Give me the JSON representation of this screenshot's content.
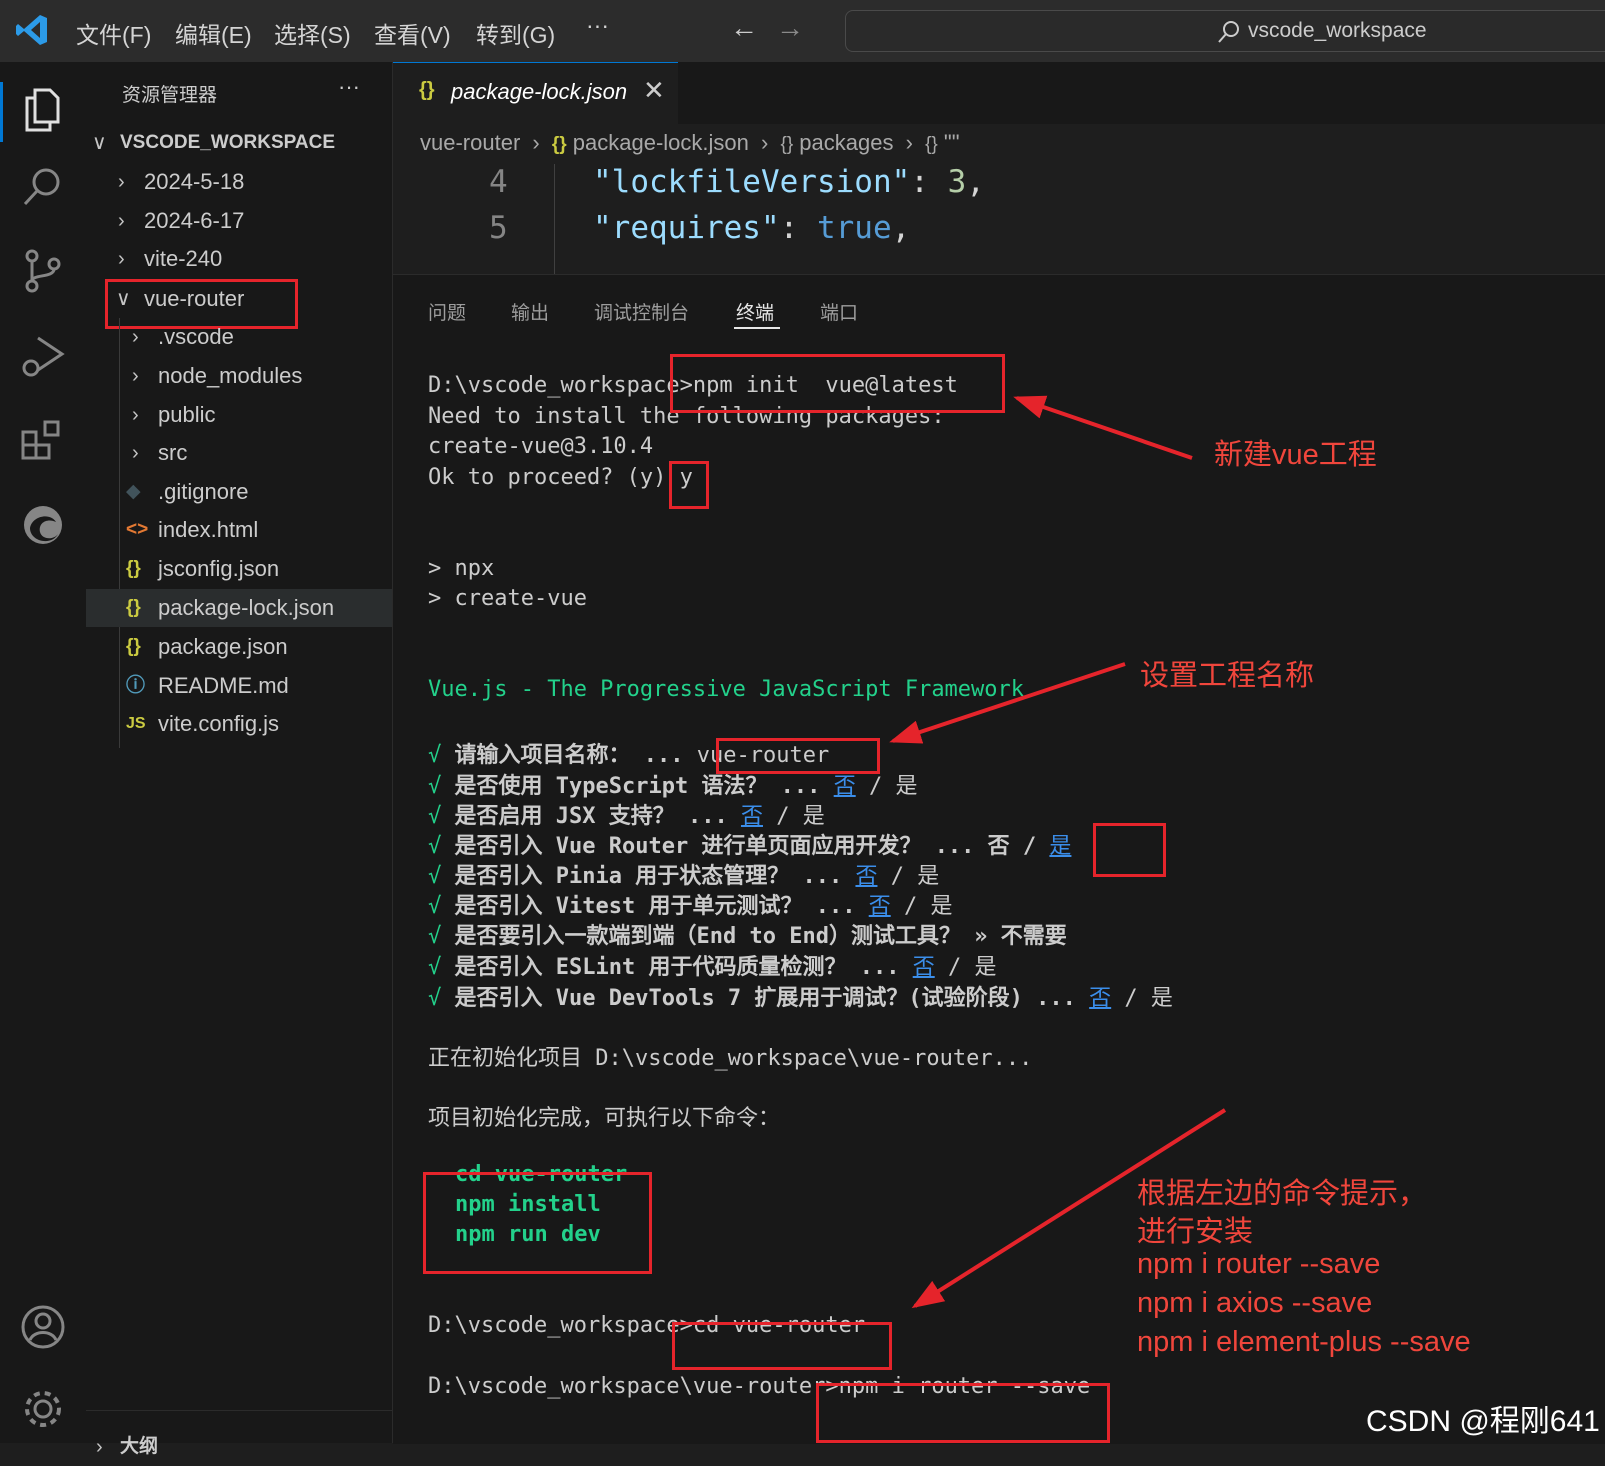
{
  "titlebar": {
    "menus": [
      "文件(F)",
      "编辑(E)",
      "选择(S)",
      "查看(V)",
      "转到(G)",
      "···"
    ],
    "search_text": "vscode_workspace"
  },
  "sidebar": {
    "title": "资源管理器",
    "more": "···",
    "workspace": "VSCODE_WORKSPACE",
    "items": [
      {
        "label": "2024-5-18",
        "type": "folder"
      },
      {
        "label": "2024-6-17",
        "type": "folder"
      },
      {
        "label": "vite-240",
        "type": "folder"
      },
      {
        "label": "vue-router",
        "type": "folder-open"
      },
      {
        "label": ".vscode",
        "type": "folder"
      },
      {
        "label": "node_modules",
        "type": "folder"
      },
      {
        "label": "public",
        "type": "folder"
      },
      {
        "label": "src",
        "type": "folder"
      },
      {
        "label": ".gitignore",
        "type": "git"
      },
      {
        "label": "index.html",
        "type": "html"
      },
      {
        "label": "jsconfig.json",
        "type": "json"
      },
      {
        "label": "package-lock.json",
        "type": "json"
      },
      {
        "label": "package.json",
        "type": "json"
      },
      {
        "label": "README.md",
        "type": "info"
      },
      {
        "label": "vite.config.js",
        "type": "js"
      }
    ],
    "outline": "大纲"
  },
  "editor": {
    "tab_label": "package-lock.json",
    "breadcrumb": [
      "vue-router",
      "package-lock.json",
      "packages",
      "\"\""
    ],
    "lines": [
      {
        "num": "4",
        "key": "\"lockfileVersion\"",
        "value": "3"
      },
      {
        "num": "5",
        "key": "\"requires\"",
        "value": "true"
      }
    ]
  },
  "panel": {
    "tabs": [
      "问题",
      "输出",
      "调试控制台",
      "终端",
      "端口"
    ],
    "active_tab": "终端"
  },
  "terminal": {
    "l1_prompt": "D:\\vscode_workspace",
    "l1_cmd": ">npm init  vue@latest",
    "l2": "Need to install the following packages:",
    "l3": "create-vue@3.10.4",
    "l4": "Ok to proceed? (y) ",
    "l4_answer": "y",
    "l5": "> npx",
    "l6": "> create-vue",
    "banner": "Vue.js - The Progressive JavaScript Framework",
    "q1": "请输入项目名称： ...",
    "q1_answer": "vue-router",
    "q2": "是否使用 TypeScript 语法？ ...",
    "q3": "是否启用 JSX 支持？ ...",
    "q4": "是否引入 Vue Router 进行单页面应用开发？ ... 否 /",
    "q5": "是否引入 Pinia 用于状态管理？ ...",
    "q6": "是否引入 Vitest 用于单元测试？ ...",
    "q7": "是否要引入一款端到端（End to End）测试工具？ » 不需要",
    "q8": "是否引入 ESLint 用于代码质量检测？ ...",
    "q9": "是否引入 Vue DevTools 7 扩展用于调试？(试验阶段) ...",
    "no": "否",
    "yes": "是",
    "sep": "/",
    "check": "√",
    "init_msg": "正在初始化项目 D:\\vscode_workspace\\vue-router...",
    "done_msg": "项目初始化完成，可执行以下命令：",
    "cmds": [
      "cd vue-router",
      "npm install",
      "npm run dev"
    ],
    "cd_prompt": "D:\\vscode_workspace",
    "cd_cmd": ">cd vue-router",
    "npm_prompt": "D:\\vscode_workspace\\vue-router",
    "npm_cmd": ">npm i router --save"
  },
  "annotations": {
    "a1": "新建vue工程",
    "a2": "设置工程名称",
    "a3": [
      "根据左边的命令提示，",
      "进行安装",
      "npm i  router   --save",
      "npm i  axios --save",
      "npm i  element-plus  --save"
    ]
  },
  "watermark": "CSDN @程刚641",
  "colors": {
    "annotation": "#e5242b",
    "check": "#23d18b",
    "link": "#3b8eea",
    "accent": "#0078d4"
  }
}
